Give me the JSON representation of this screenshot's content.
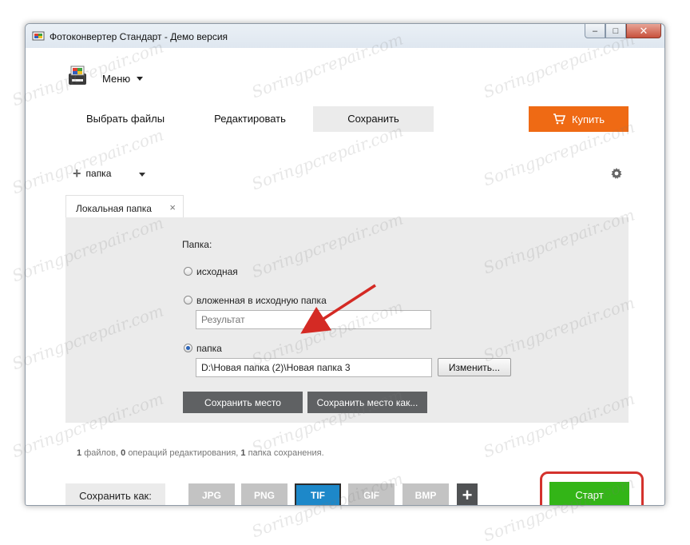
{
  "window": {
    "title": "Фотоконвертер Стандарт - Демо версия",
    "controls": {
      "minimize": "–",
      "maximize": "□",
      "close": "✕"
    }
  },
  "menu": {
    "label": "Меню"
  },
  "tabs": [
    {
      "label": "Выбрать файлы",
      "active": false
    },
    {
      "label": "Редактировать",
      "active": false
    },
    {
      "label": "Сохранить",
      "active": true
    }
  ],
  "buy_button": {
    "label": "Купить",
    "color": "#ef6a14"
  },
  "folder_toolbar": {
    "label": "папка"
  },
  "panel_tab": {
    "label": "Локальная папка",
    "close": "×"
  },
  "folder_options": {
    "heading": "Папка:",
    "source": {
      "label": "исходная",
      "checked": false
    },
    "subfolder": {
      "label": "вложенная в исходную папка",
      "checked": false,
      "placeholder": "Результат"
    },
    "custom": {
      "label": "папка",
      "checked": true,
      "value": "D:\\Новая папка (2)\\Новая папка 3"
    },
    "change_button": "Изменить...",
    "save_location": "Сохранить место",
    "save_location_as": "Сохранить место как..."
  },
  "status": {
    "files_count": "1",
    "files_text": "файлов,",
    "ops_count": "0",
    "ops_text": "операций редактирования,",
    "folders_count": "1",
    "folders_text": "папка сохранения."
  },
  "save_as": {
    "label": "Сохранить как:"
  },
  "formats": [
    {
      "label": "JPG",
      "active": false
    },
    {
      "label": "PNG",
      "active": false
    },
    {
      "label": "TIF",
      "active": true
    },
    {
      "label": "GIF",
      "active": false
    },
    {
      "label": "BMP",
      "active": false
    }
  ],
  "add_format": "+",
  "start_button": {
    "label": "Старт",
    "color": "#33b517"
  },
  "watermark": "Soringpcrepair.com",
  "colors": {
    "accent_blue": "#1d88c9",
    "highlight_red": "#d4322d"
  }
}
